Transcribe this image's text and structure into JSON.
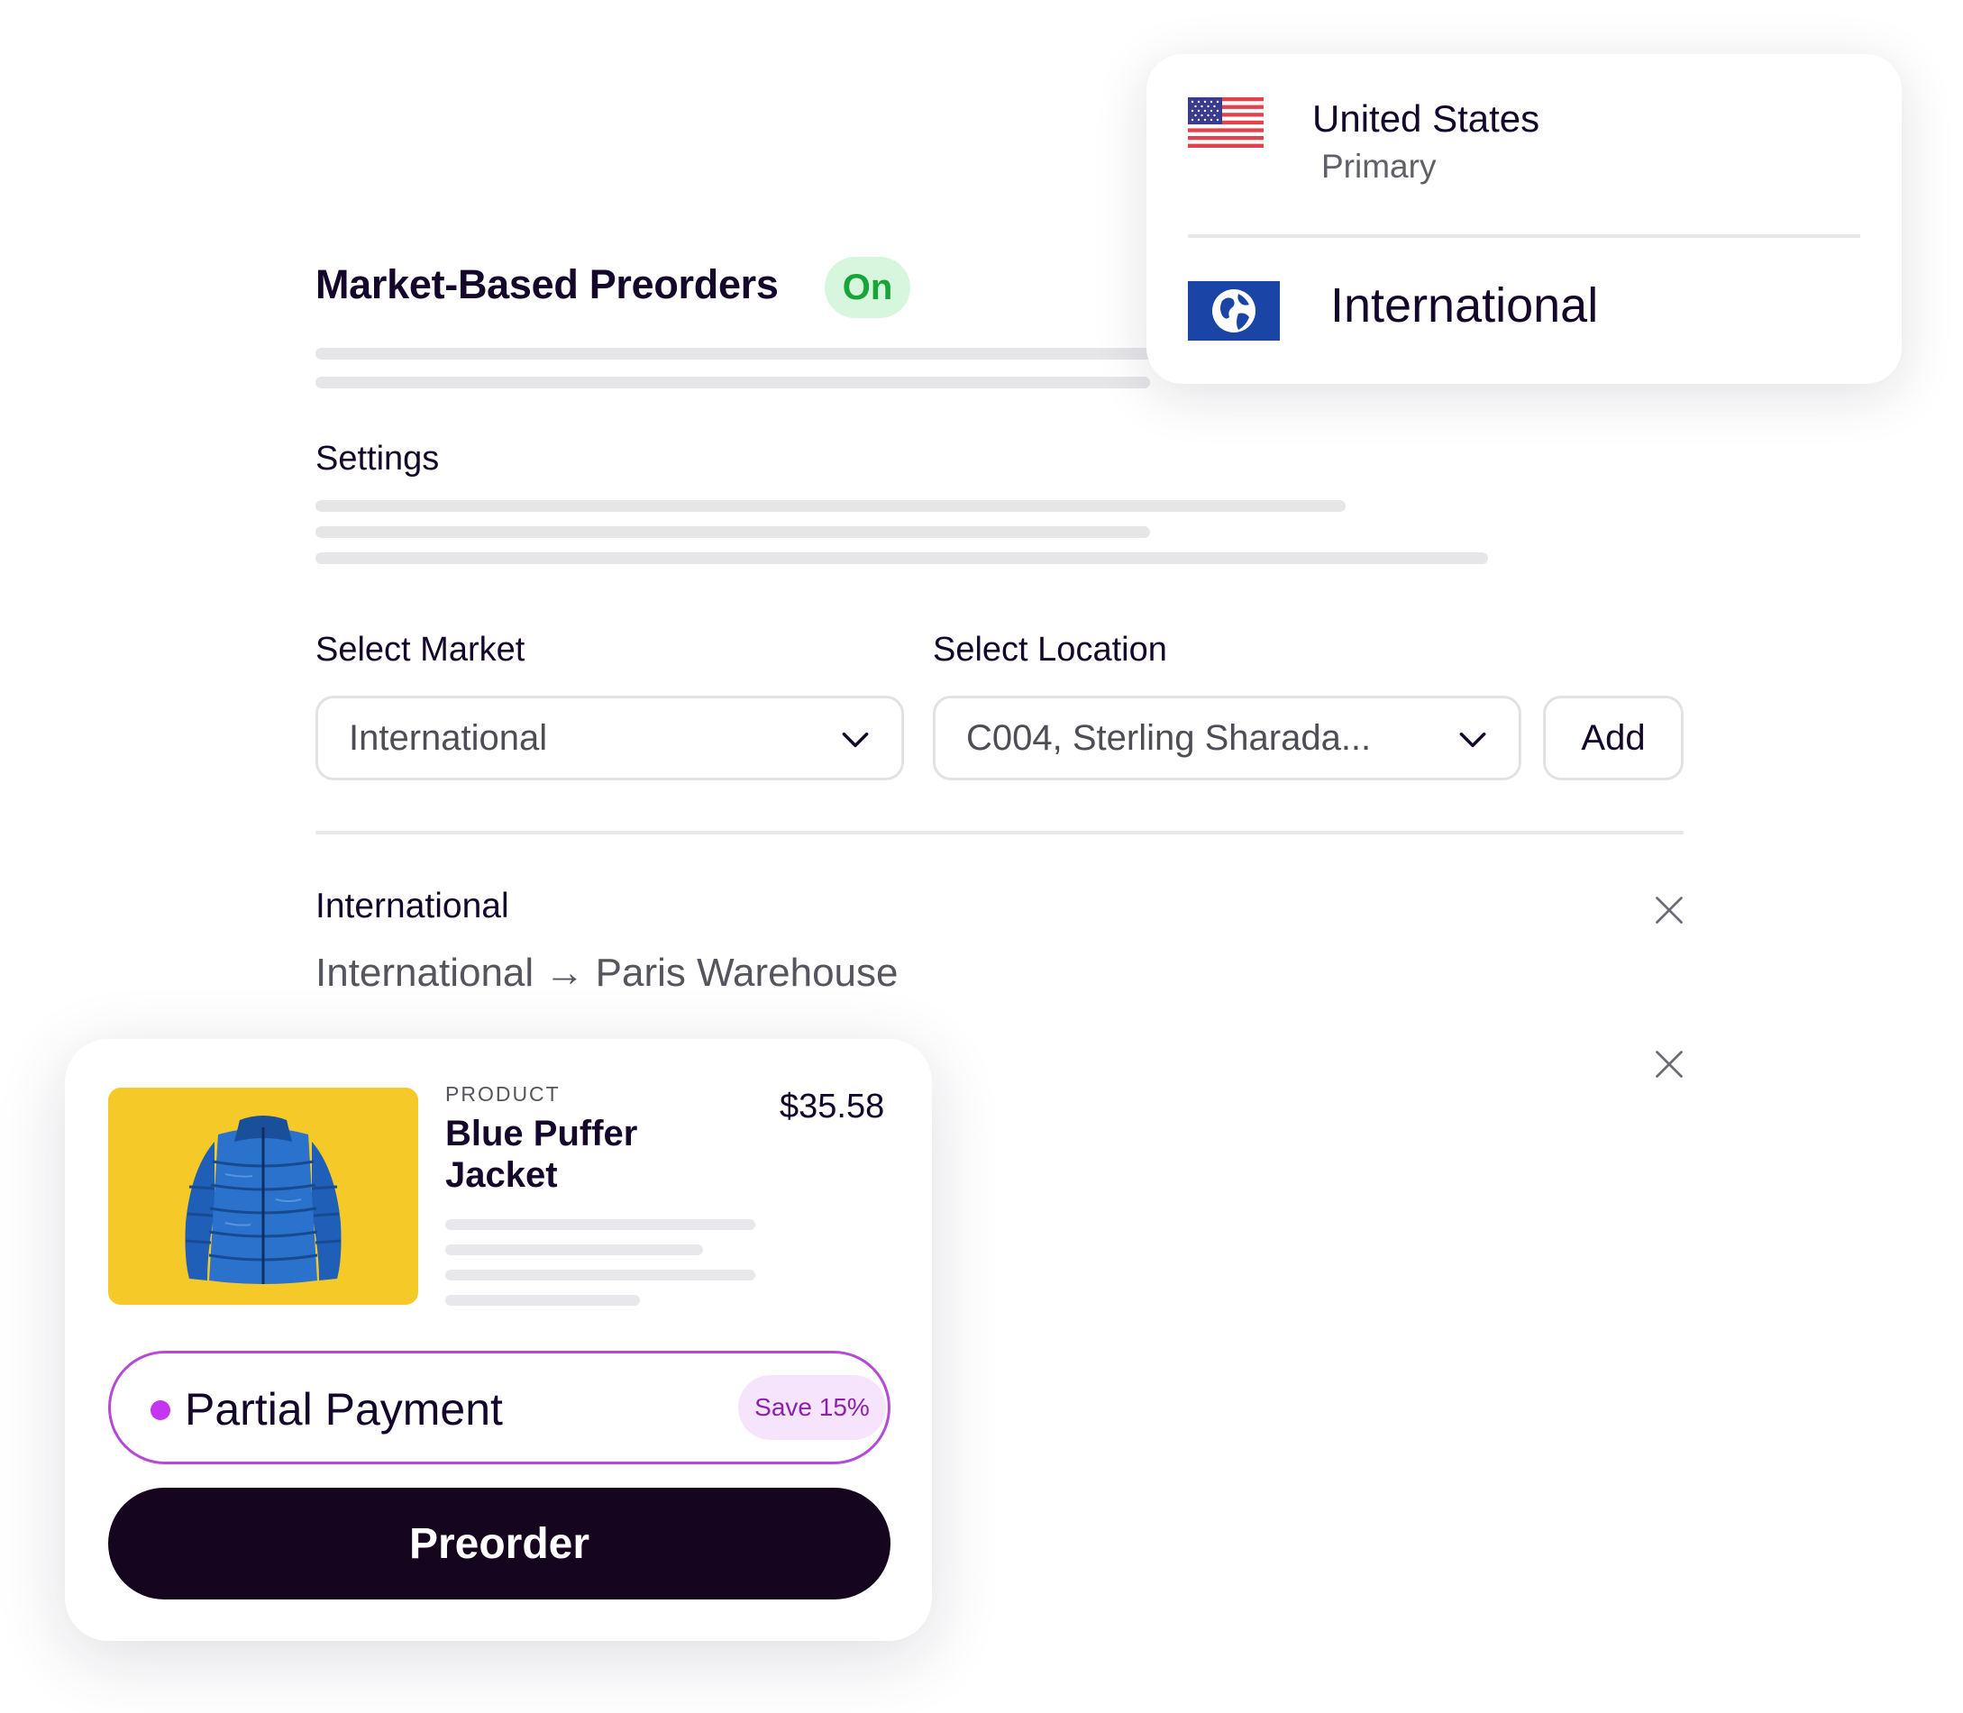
{
  "settings_panel": {
    "title": "Market-Based Preorders",
    "status": "On",
    "section_title": "Settings"
  },
  "form": {
    "market_label": "Select Market",
    "market_value": "International",
    "location_label": "Select Location",
    "location_value": "C004, Sterling Sharada...",
    "add_label": "Add"
  },
  "assignments": [
    {
      "title": "International",
      "route_from": "International",
      "arrow": "→",
      "route_to": "Paris Warehouse"
    }
  ],
  "market_popover": {
    "options": [
      {
        "name": "United States",
        "subtitle": "Primary",
        "icon": "us-flag-icon"
      },
      {
        "name": "International",
        "icon": "globe-icon"
      }
    ]
  },
  "product_card": {
    "kicker": "PRODUCT",
    "name": "Blue Puffer Jacket",
    "price": "$35.58",
    "image_icon": "jacket-icon",
    "payment_option": {
      "label": "Partial Payment",
      "badge": "Save 15%"
    },
    "cta": "Preorder"
  },
  "colors": {
    "text_primary": "#15072b",
    "status_on_bg": "#d6f6dd",
    "status_on_text": "#17a438",
    "accent_purple": "#b54ad6",
    "button_dark": "#16051f",
    "product_bg": "#f5c928",
    "globe_bg": "#1a45a6"
  }
}
